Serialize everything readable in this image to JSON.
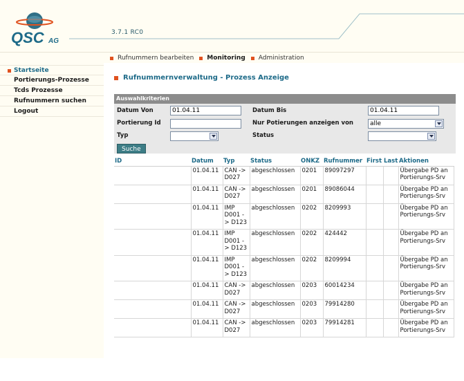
{
  "header": {
    "logo_text": "QSC",
    "logo_suffix": "AG",
    "version": "3.7.1 RC0"
  },
  "topnav": {
    "items": [
      {
        "label": "Rufnummern bearbeiten",
        "active": false
      },
      {
        "label": "Monitoring",
        "active": true
      },
      {
        "label": "Administration",
        "active": false
      }
    ]
  },
  "leftnav": {
    "items": [
      {
        "label": "Startseite",
        "selected": true
      },
      {
        "label": "Portierungs-Prozesse",
        "selected": false
      },
      {
        "label": "Tcds Prozesse",
        "selected": false
      },
      {
        "label": "Rufnummern suchen",
        "selected": false
      },
      {
        "label": "Logout",
        "selected": false
      }
    ]
  },
  "page": {
    "title": "Rufnummernverwaltung - Prozess Anzeige"
  },
  "criteria": {
    "caption": "Auswahlkriterien",
    "datum_von_label": "Datum Von",
    "datum_von_value": "01.04.11",
    "datum_bis_label": "Datum Bis",
    "datum_bis_value": "01.04.11",
    "portierung_id_label": "Portierung Id",
    "portierung_id_value": "",
    "nur_label": "Nur Potierungen anzeigen von",
    "nur_value": "alle",
    "typ_label": "Typ",
    "typ_value": "",
    "status_label": "Status",
    "status_value": "",
    "search_label": "Suche"
  },
  "table": {
    "columns": [
      "ID",
      "Datum",
      "Typ",
      "Status",
      "ONKZ",
      "Rufnummer",
      "First",
      "Last",
      "Aktionen"
    ],
    "rows": [
      {
        "id": "",
        "datum": "01.04.11",
        "typ": "CAN -> D027",
        "status": "abgeschlossen",
        "onkz": "0201",
        "rufnummer": "89097297",
        "first": "",
        "last": "",
        "aktion": "Übergabe PD an Portierungs-Srv"
      },
      {
        "id": "",
        "datum": "01.04.11",
        "typ": "CAN -> D027",
        "status": "abgeschlossen",
        "onkz": "0201",
        "rufnummer": "89086044",
        "first": "",
        "last": "",
        "aktion": "Übergabe PD an Portierungs-Srv"
      },
      {
        "id": "",
        "datum": "01.04.11",
        "typ": "IMP D001 -> D123",
        "status": "abgeschlossen",
        "onkz": "0202",
        "rufnummer": "8209993",
        "first": "",
        "last": "",
        "aktion": "Übergabe PD an Portierungs-Srv"
      },
      {
        "id": "",
        "datum": "01.04.11",
        "typ": "IMP D001 -> D123",
        "status": "abgeschlossen",
        "onkz": "0202",
        "rufnummer": "424442",
        "first": "",
        "last": "",
        "aktion": "Übergabe PD an Portierungs-Srv"
      },
      {
        "id": "",
        "datum": "01.04.11",
        "typ": "IMP D001 -> D123",
        "status": "abgeschlossen",
        "onkz": "0202",
        "rufnummer": "8209994",
        "first": "",
        "last": "",
        "aktion": "Übergabe PD an Portierungs-Srv"
      },
      {
        "id": "",
        "datum": "01.04.11",
        "typ": "CAN -> D027",
        "status": "abgeschlossen",
        "onkz": "0203",
        "rufnummer": "60014234",
        "first": "",
        "last": "",
        "aktion": "Übergabe PD an Portierungs-Srv"
      },
      {
        "id": "",
        "datum": "01.04.11",
        "typ": "CAN -> D027",
        "status": "abgeschlossen",
        "onkz": "0203",
        "rufnummer": "79914280",
        "first": "",
        "last": "",
        "aktion": "Übergabe PD an Portierungs-Srv"
      },
      {
        "id": "",
        "datum": "01.04.11",
        "typ": "CAN -> D027",
        "status": "abgeschlossen",
        "onkz": "0203",
        "rufnummer": "79914281",
        "first": "",
        "last": "",
        "aktion": "Übergabe PD an Portierungs-Srv"
      }
    ]
  },
  "colors": {
    "accent_orange": "#e0521f",
    "title_teal": "#1d6a88",
    "button_teal": "#3d7d86",
    "header_bg": "#fffdf3"
  }
}
